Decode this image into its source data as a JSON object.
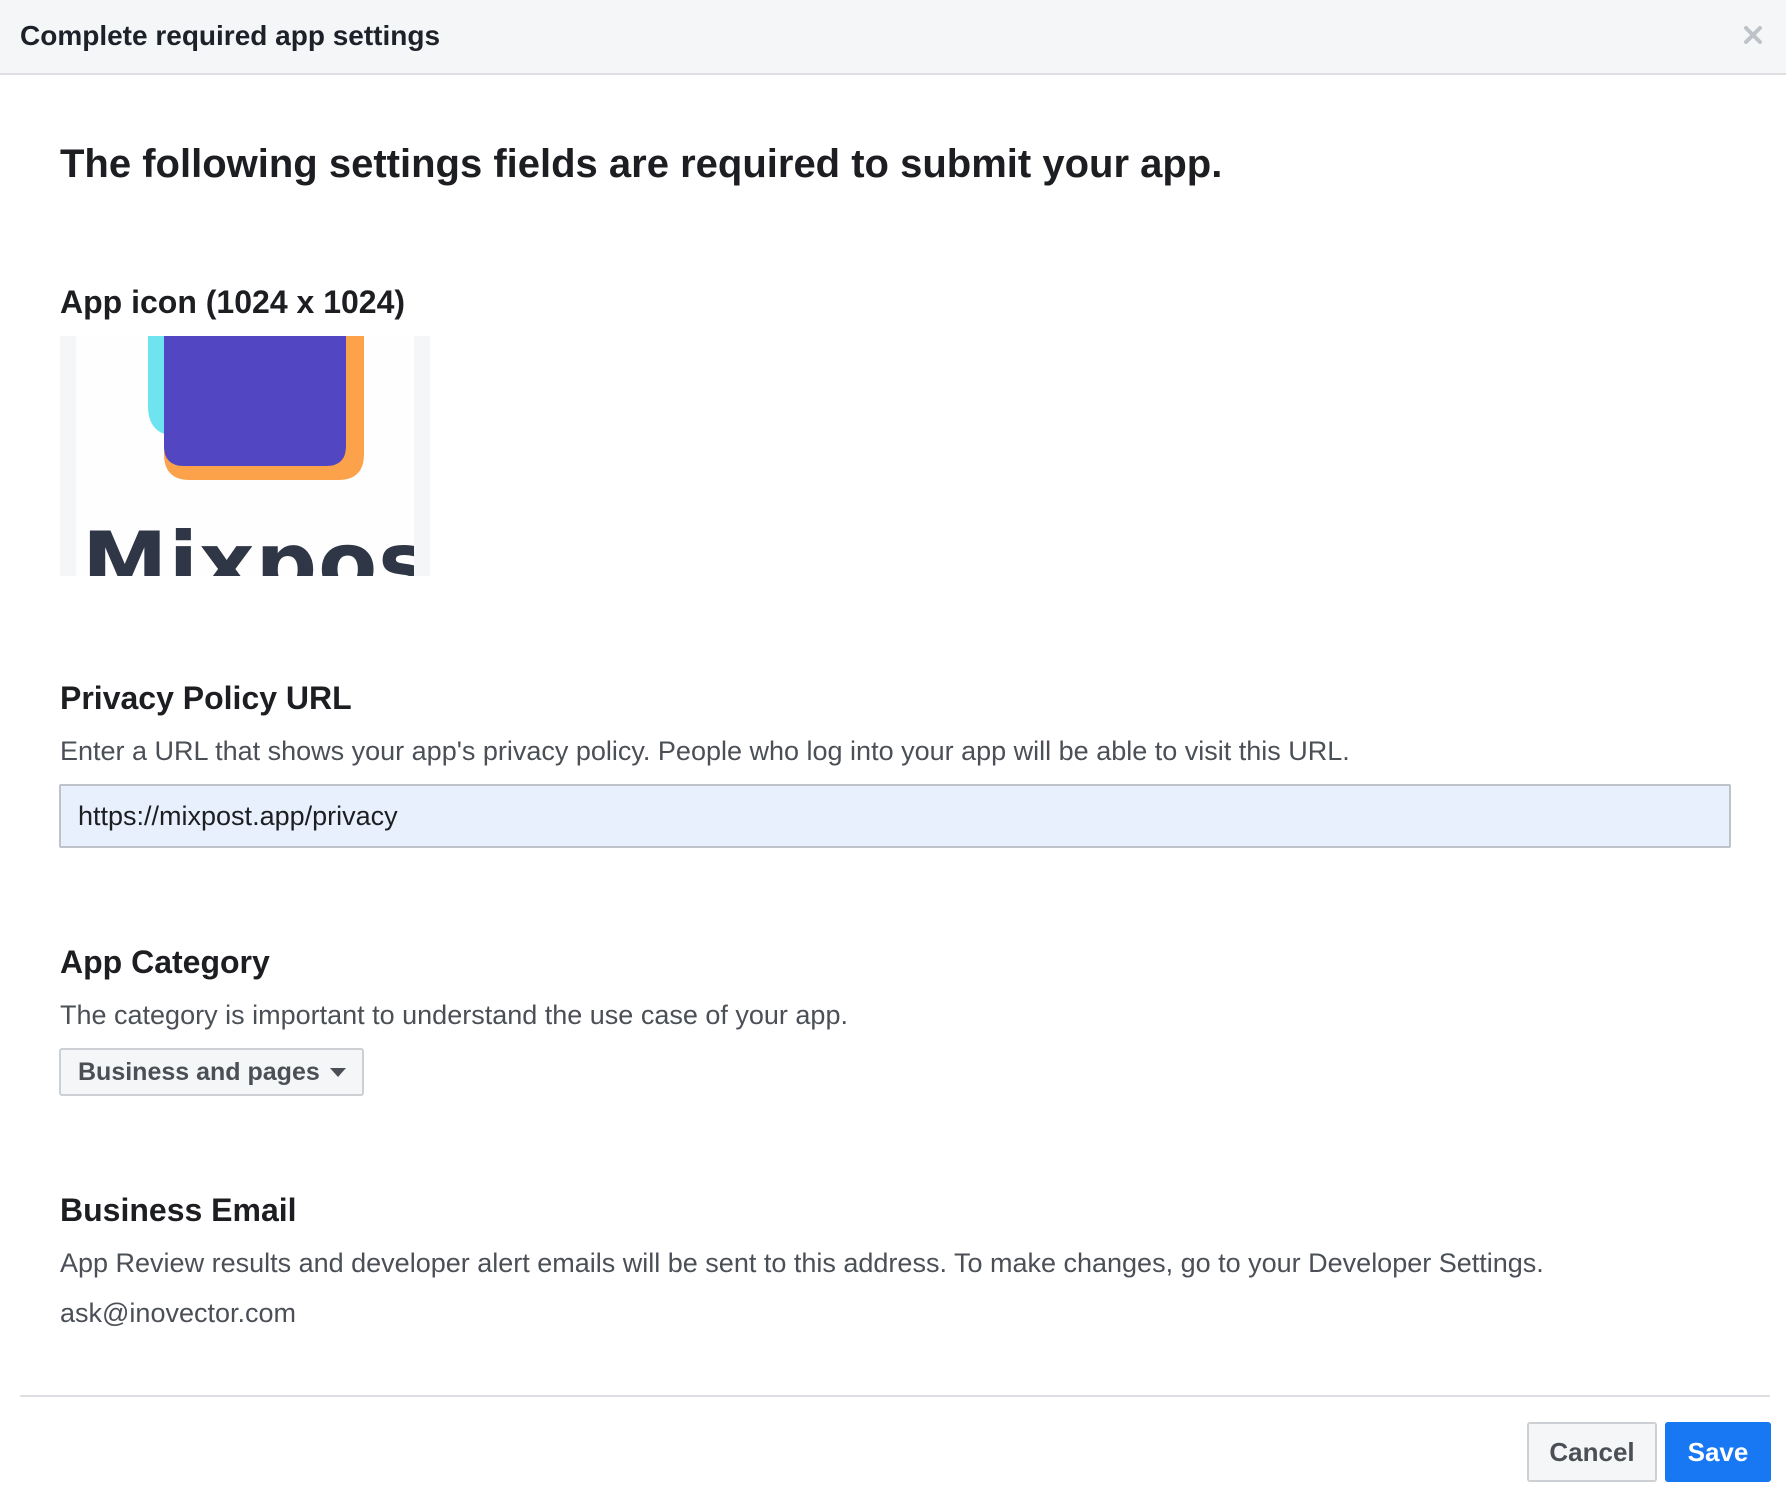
{
  "dialog": {
    "title": "Complete required app settings",
    "close_icon": "close-icon"
  },
  "main": {
    "heading": "The following settings fields are required to submit your app."
  },
  "app_icon": {
    "title": "App icon (1024 x 1024)",
    "logo_text": "Mixpost"
  },
  "privacy": {
    "title": "Privacy Policy URL",
    "description": "Enter a URL that shows your app's privacy policy. People who log into your app will be able to visit this URL.",
    "value": "https://mixpost.app/privacy"
  },
  "category": {
    "title": "App Category",
    "description": "The category is important to understand the use case of your app.",
    "selected": "Business and pages",
    "caret_icon": "caret-down-icon"
  },
  "business_email": {
    "title": "Business Email",
    "description": "App Review results and developer alert emails will be sent to this address. To make changes, go to your Developer Settings.",
    "value": "ask@inovector.com"
  },
  "footer": {
    "cancel_label": "Cancel",
    "save_label": "Save"
  },
  "colors": {
    "primary": "#1877f2",
    "header_bg": "#f5f6f7",
    "input_autofill_bg": "#e8f0fe",
    "logo_purple": "#5246c2",
    "logo_orange": "#fba24a",
    "logo_cyan": "#6ee4f0"
  }
}
